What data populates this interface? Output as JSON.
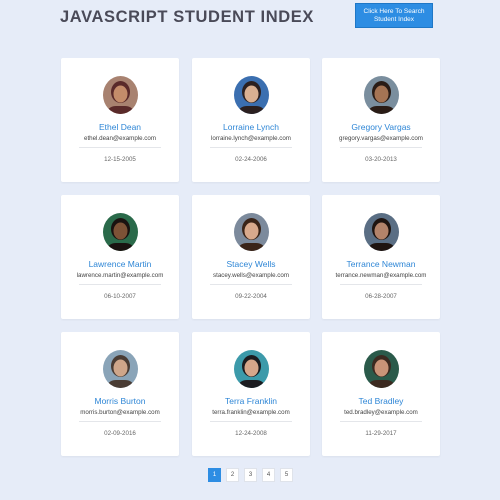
{
  "header": {
    "title": "JAVASCRIPT STUDENT INDEX",
    "search_button": "Click Here To Search Student Index"
  },
  "students": [
    {
      "name": "Ethel Dean",
      "email": "ethel.dean@example.com",
      "date": "12-15-2005",
      "skin": "#c48c6a",
      "hair": "#5a2a2a",
      "bg": "#a88270"
    },
    {
      "name": "Lorraine Lynch",
      "email": "lorraine.lynch@example.com",
      "date": "02-24-2006",
      "skin": "#d9b092",
      "hair": "#2b2020",
      "bg": "#3b6fb0"
    },
    {
      "name": "Gregory Vargas",
      "email": "gregory.vargas@example.com",
      "date": "03-20-2013",
      "skin": "#a57454",
      "hair": "#2a1c16",
      "bg": "#7a8e9e"
    },
    {
      "name": "Lawrence Martin",
      "email": "lawrence.martin@example.com",
      "date": "06-10-2007",
      "skin": "#7d5236",
      "hair": "#1a1210",
      "bg": "#2a6a4a"
    },
    {
      "name": "Stacey Wells",
      "email": "stacey.wells@example.com",
      "date": "09-22-2004",
      "skin": "#d8a98c",
      "hair": "#3a2418",
      "bg": "#7c8a9c"
    },
    {
      "name": "Terrance Newman",
      "email": "terrance.newman@example.com",
      "date": "06-28-2007",
      "skin": "#b3836a",
      "hair": "#1f1410",
      "bg": "#5a6e84"
    },
    {
      "name": "Morris Burton",
      "email": "morris.burton@example.com",
      "date": "02-09-2016",
      "skin": "#cfa68a",
      "hair": "#4a3c34",
      "bg": "#8aa4b8"
    },
    {
      "name": "Terra Franklin",
      "email": "terra.franklin@example.com",
      "date": "12-24-2008",
      "skin": "#d6a68a",
      "hair": "#1c1c20",
      "bg": "#3c9aaa"
    },
    {
      "name": "Ted Bradley",
      "email": "ted.bradley@example.com",
      "date": "11-29-2017",
      "skin": "#c99478",
      "hair": "#3c2a20",
      "bg": "#2a5a4a"
    }
  ],
  "pagination": {
    "pages": [
      "1",
      "2",
      "3",
      "4",
      "5"
    ],
    "active": "1"
  }
}
